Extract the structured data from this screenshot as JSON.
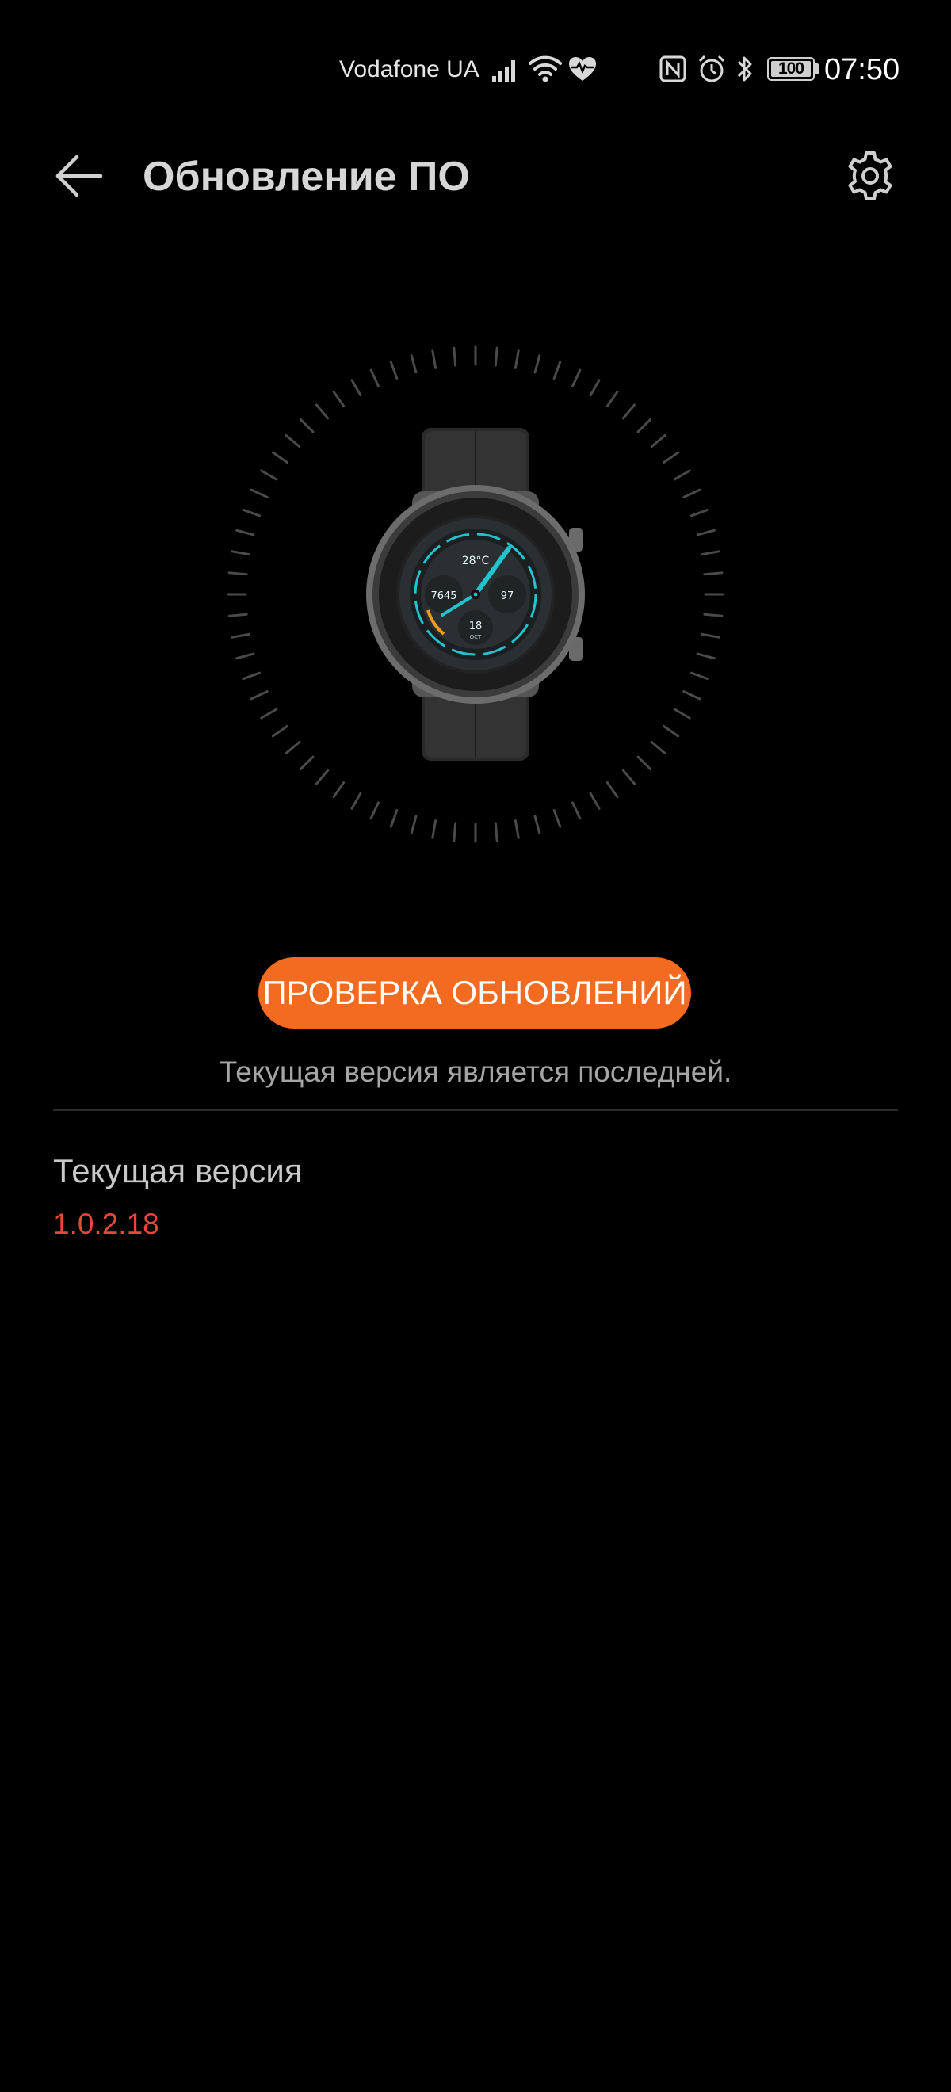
{
  "status_bar": {
    "carrier": "Vodafone UA",
    "battery": "100",
    "time": "07:50",
    "icons": [
      "signal-icon",
      "wifi-icon",
      "heart-rate-icon",
      "nfc-icon",
      "alarm-icon",
      "bluetooth-icon",
      "battery-icon"
    ]
  },
  "header": {
    "title": "Обновление ПО",
    "back_icon": "arrow-left-icon",
    "settings_icon": "gear-icon"
  },
  "watch": {
    "face_temp": "28°C",
    "face_steps": "7645",
    "face_heart": "97",
    "face_date": "18",
    "face_month": "OCT"
  },
  "update": {
    "button_label": "ПРОВЕРКА ОБНОВЛЕНИЙ",
    "status": "Текущая версия является последней."
  },
  "current_version": {
    "label": "Текущая версия",
    "value": "1.0.2.18"
  },
  "colors": {
    "accent": "#f36b21",
    "version": "#e8473a",
    "background": "#000000"
  }
}
